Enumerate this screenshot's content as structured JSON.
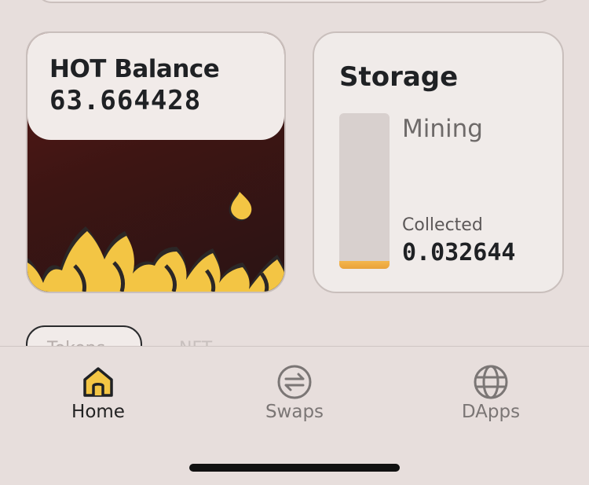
{
  "hot_card": {
    "title": "HOT Balance",
    "balance": "63.664428"
  },
  "storage_card": {
    "title": "Storage",
    "status": "Mining",
    "collected_label": "Collected",
    "collected_value": "0.032644",
    "fill_fraction": 0.05,
    "fill_color": "#f0ad45"
  },
  "tabs_row": {
    "first_tab": "Tokens",
    "second_tab": "NFT"
  },
  "bottom_nav": [
    {
      "label": "Home",
      "icon": "home-icon",
      "active": true
    },
    {
      "label": "Swaps",
      "icon": "swap-icon",
      "active": false
    },
    {
      "label": "DApps",
      "icon": "globe-icon",
      "active": false
    }
  ],
  "colors": {
    "accent": "#f3c544",
    "card_dark": "#4a1817",
    "background": "#e7dedc"
  }
}
